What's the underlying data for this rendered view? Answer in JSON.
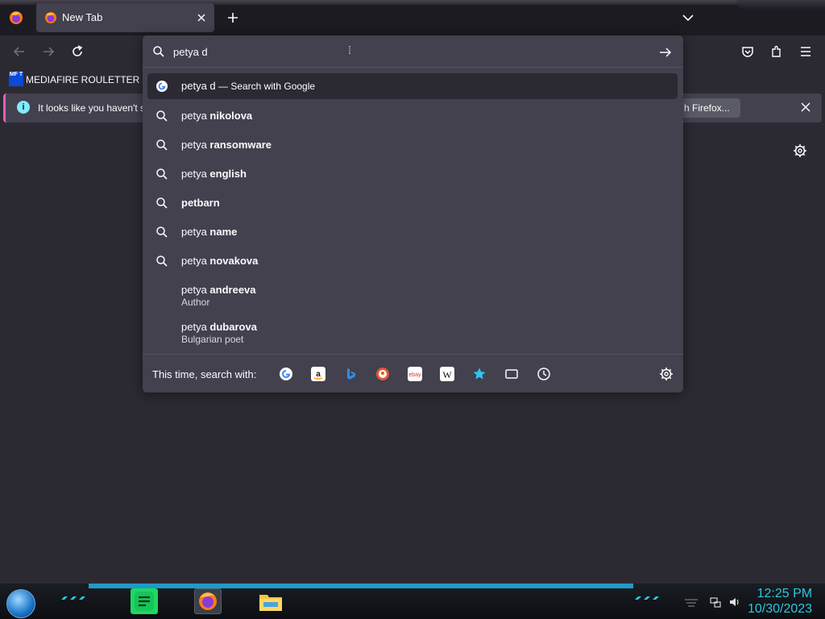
{
  "browser": {
    "tab": {
      "title": "New Tab"
    },
    "bookmark": {
      "label": "MEDIAFIRE ROULETTER",
      "icon_text": "MF T"
    },
    "notification": {
      "message": "It looks like you haven't s",
      "button_label": "h Firefox..."
    }
  },
  "urlbar": {
    "query": "petya d",
    "suggestions": [
      {
        "prefix": "petya d",
        "bold": "",
        "note": " — Search with Google",
        "icon": "google-icon"
      },
      {
        "prefix": "petya ",
        "bold": "nikolova"
      },
      {
        "prefix": "petya ",
        "bold": "ransomware"
      },
      {
        "prefix": "petya ",
        "bold": "english"
      },
      {
        "prefix": "",
        "bold": "petbarn"
      },
      {
        "prefix": "petya ",
        "bold": "name"
      },
      {
        "prefix": "petya ",
        "bold": "novakova"
      },
      {
        "prefix": "petya ",
        "bold": "andreeva",
        "desc": "Author"
      },
      {
        "prefix": "petya ",
        "bold": "dubarova",
        "desc": "Bulgarian poet"
      }
    ],
    "engines_label": "This time, search with:",
    "engines": [
      "google-icon",
      "amazon-icon",
      "bing-icon",
      "duckduckgo-icon",
      "ebay-icon",
      "wikipedia-icon",
      "bookmarks-icon",
      "tabs-icon",
      "history-icon"
    ]
  },
  "taskbar": {
    "time": "12:25 PM",
    "date": "10/30/2023"
  },
  "colors": {
    "accent": "#80ebff",
    "panel": "#42414d",
    "background": "#2b2a33",
    "clock": "#2bc8e0"
  }
}
